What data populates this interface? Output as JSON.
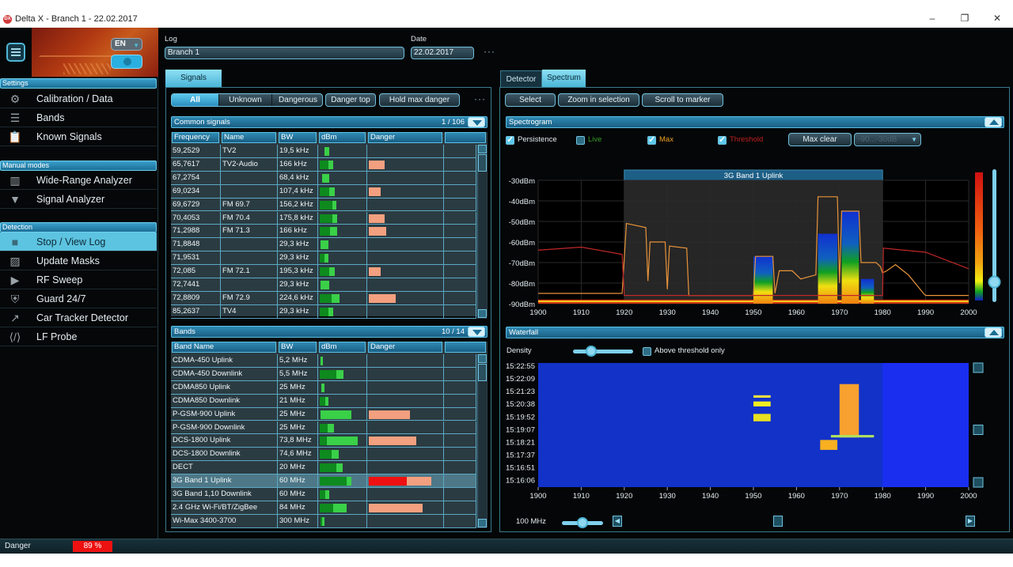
{
  "window": {
    "title": "Delta X - Branch 1 - 22.02.2017",
    "app_icon": "DX",
    "minimize": "–",
    "maximize": "❐",
    "close": "✕"
  },
  "sidebar": {
    "language": "EN",
    "sections": [
      {
        "label": "Settings",
        "items": [
          {
            "label": "Calibration / Data",
            "icon": "gear-icon",
            "glyph": "⚙"
          },
          {
            "label": "Bands",
            "icon": "list-icon",
            "glyph": "☰"
          },
          {
            "label": "Known Signals",
            "icon": "clipboard-icon",
            "glyph": "📋"
          }
        ]
      },
      {
        "label": "Manual modes",
        "items": [
          {
            "label": "Wide-Range Analyzer",
            "icon": "bar-chart-icon",
            "glyph": "▥"
          },
          {
            "label": "Signal Analyzer",
            "icon": "info-shield-icon",
            "glyph": "▼"
          }
        ]
      },
      {
        "label": "Detection",
        "items": [
          {
            "label": "Stop / View Log",
            "icon": "stop-icon",
            "glyph": "■",
            "active": true
          },
          {
            "label": "Update Masks",
            "icon": "image-icon",
            "glyph": "▨"
          },
          {
            "label": "RF Sweep",
            "icon": "play-icon",
            "glyph": "▶"
          },
          {
            "label": "Guard 24/7",
            "icon": "shield-check-icon",
            "glyph": "⛨"
          },
          {
            "label": "Car Tracker Detector",
            "icon": "trend-icon",
            "glyph": "↗"
          },
          {
            "label": "LF Probe",
            "icon": "code-link-icon",
            "glyph": "⟨/⟩"
          }
        ]
      }
    ]
  },
  "header": {
    "log_label": "Log",
    "log_value": "Branch 1",
    "date_label": "Date",
    "date_value": "22.02.2017",
    "more": "···"
  },
  "signals": {
    "tab": "Signals",
    "filters": [
      "All",
      "Unknown",
      "Dangerous"
    ],
    "active_filter": "All",
    "danger_top": "Danger top",
    "hold_max_danger": "Hold max danger",
    "more": "···",
    "common": {
      "title": "Common signals",
      "count": "1 / 106",
      "columns": [
        "Frequency",
        "Name",
        "BW",
        "dBm",
        "Danger",
        ""
      ],
      "rows": [
        {
          "freq": "59,2529",
          "name": "TV2",
          "bw": "19,5 kHz",
          "dbm_dark": 0.0,
          "dbm_light": 0.12,
          "dbm_offset": 0.1,
          "danger": 0
        },
        {
          "freq": "65,7617",
          "name": "TV2-Audio",
          "bw": "166 kHz",
          "dbm_dark": 0.2,
          "dbm_light": 0.1,
          "dbm_offset": 0,
          "danger": 0.22
        },
        {
          "freq": "67,2754",
          "name": "",
          "bw": "68,4 kHz",
          "dbm_dark": 0.0,
          "dbm_light": 0.15,
          "dbm_offset": 0.06,
          "danger": 0
        },
        {
          "freq": "69,0234",
          "name": "",
          "bw": "107,4 kHz",
          "dbm_dark": 0.22,
          "dbm_light": 0.12,
          "dbm_offset": 0,
          "danger": 0.17
        },
        {
          "freq": "69,6729",
          "name": "FM 69.7",
          "bw": "156,2 kHz",
          "dbm_dark": 0.28,
          "dbm_light": 0.1,
          "dbm_offset": 0,
          "danger": 0
        },
        {
          "freq": "70,4053",
          "name": "FM 70.4",
          "bw": "175,8 kHz",
          "dbm_dark": 0.28,
          "dbm_light": 0.12,
          "dbm_offset": 0,
          "danger": 0.22
        },
        {
          "freq": "71,2988",
          "name": "FM 71.3",
          "bw": "166 kHz",
          "dbm_dark": 0.24,
          "dbm_light": 0.16,
          "dbm_offset": 0,
          "danger": 0.24
        },
        {
          "freq": "71,8848",
          "name": "",
          "bw": "29,3 kHz",
          "dbm_dark": 0.0,
          "dbm_light": 0.18,
          "dbm_offset": 0.02,
          "danger": 0
        },
        {
          "freq": "71,9531",
          "name": "",
          "bw": "29,3 kHz",
          "dbm_dark": 0.1,
          "dbm_light": 0.1,
          "dbm_offset": 0,
          "danger": 0
        },
        {
          "freq": "72,085",
          "name": "FM 72.1",
          "bw": "195,3 kHz",
          "dbm_dark": 0.22,
          "dbm_light": 0.12,
          "dbm_offset": 0,
          "danger": 0.17
        },
        {
          "freq": "72,7441",
          "name": "",
          "bw": "29,3 kHz",
          "dbm_dark": 0.0,
          "dbm_light": 0.2,
          "dbm_offset": 0.02,
          "danger": 0
        },
        {
          "freq": "72,8809",
          "name": "FM 72.9",
          "bw": "224,6 kHz",
          "dbm_dark": 0.26,
          "dbm_light": 0.18,
          "dbm_offset": 0,
          "danger": 0.37
        },
        {
          "freq": "85,2637",
          "name": "TV4",
          "bw": "29,3 kHz",
          "dbm_dark": 0.2,
          "dbm_light": 0.1,
          "dbm_offset": 0,
          "danger": 0
        }
      ]
    },
    "bands": {
      "title": "Bands",
      "count": "10 / 14",
      "columns": [
        "Band Name",
        "BW",
        "dBm",
        "Danger",
        ""
      ],
      "rows": [
        {
          "name": "CDMA-450 Uplink",
          "bw": "5,2 MHz",
          "dbm_dark": 0.0,
          "dbm_light": 0.05,
          "dbm_offset": 0.02,
          "danger": 0,
          "danger_red": 0
        },
        {
          "name": "CDMA-450 Downlink",
          "bw": "5,5 MHz",
          "dbm_dark": 0.38,
          "dbm_light": 0.15,
          "dbm_offset": 0,
          "danger": 0,
          "danger_red": 0
        },
        {
          "name": "CDMA850 Uplink",
          "bw": "25 MHz",
          "dbm_dark": 0.0,
          "dbm_light": 0.07,
          "dbm_offset": 0.04,
          "danger": 0,
          "danger_red": 0
        },
        {
          "name": "CDMA850 Downlink",
          "bw": "21 MHz",
          "dbm_dark": 0.12,
          "dbm_light": 0.08,
          "dbm_offset": 0,
          "danger": 0,
          "danger_red": 0
        },
        {
          "name": "P-GSM-900 Uplink",
          "bw": "25 MHz",
          "dbm_dark": 0.0,
          "dbm_light": 0.7,
          "dbm_offset": 0.02,
          "danger": 0.57,
          "danger_red": 0
        },
        {
          "name": "P-GSM-900 Downlink",
          "bw": "25 MHz",
          "dbm_dark": 0.18,
          "dbm_light": 0.14,
          "dbm_offset": 0,
          "danger": 0,
          "danger_red": 0
        },
        {
          "name": "DCS-1800 Uplink",
          "bw": "73,8 MHz",
          "dbm_dark": 0.16,
          "dbm_light": 0.7,
          "dbm_offset": 0,
          "danger": 0.66,
          "danger_red": 0
        },
        {
          "name": "DCS-1800 Downlink",
          "bw": "74,6 MHz",
          "dbm_dark": 0.27,
          "dbm_light": 0.16,
          "dbm_offset": 0,
          "danger": 0,
          "danger_red": 0
        },
        {
          "name": "DECT",
          "bw": "20 MHz",
          "dbm_dark": 0.38,
          "dbm_light": 0.14,
          "dbm_offset": 0,
          "danger": 0,
          "danger_red": 0
        },
        {
          "name": "3G Band 1 Uplink",
          "bw": "60 MHz",
          "dbm_dark": 0.6,
          "dbm_light": 0.12,
          "dbm_offset": 0,
          "danger": 0.87,
          "danger_red": 0.53,
          "selected": true
        },
        {
          "name": "3G Band 1,10 Downlink",
          "bw": "60 MHz",
          "dbm_dark": 0.12,
          "dbm_light": 0.1,
          "dbm_offset": 0,
          "danger": 0,
          "danger_red": 0
        },
        {
          "name": "2.4 GHz Wi-Fi/BT/ZigBee",
          "bw": "84 MHz",
          "dbm_dark": 0.3,
          "dbm_light": 0.3,
          "dbm_offset": 0,
          "danger": 0.75,
          "danger_red": 0
        },
        {
          "name": "Wi-Max 3400-3700",
          "bw": "300 MHz",
          "dbm_dark": 0.04,
          "dbm_light": 0.04,
          "dbm_offset": 0.02,
          "danger": 0,
          "danger_red": 0
        }
      ]
    }
  },
  "spectrum_panel": {
    "tabs": [
      "Detector",
      "Spectrum"
    ],
    "active_tab": "Spectrum",
    "toolbar": [
      "Select",
      "Zoom in selection",
      "Scroll to marker"
    ],
    "spectrogram": {
      "title": "Spectrogram",
      "checks": [
        {
          "label": "Persistence",
          "checked": true,
          "color": "#e6eef2"
        },
        {
          "label": "Live",
          "checked": false,
          "color": "#3a9a2a"
        },
        {
          "label": "Max",
          "checked": true,
          "color": "#f0a020"
        },
        {
          "label": "Threshold",
          "checked": true,
          "color": "#c02020"
        }
      ],
      "max_clear": "Max clear",
      "range_select": "-90...-30dB"
    },
    "waterfall": {
      "title": "Waterfall",
      "density_label": "Density",
      "density_value": 0.3,
      "above_threshold_label": "Above threshold only",
      "above_threshold_checked": false,
      "span_label": "100 MHz",
      "span_slider": 0.5,
      "h_scroll": 0.45
    }
  },
  "chart_data": [
    {
      "type": "line",
      "title": "Spectrogram",
      "xlabel": "",
      "ylabel": "",
      "xlim": [
        1900,
        2000
      ],
      "ylim": [
        -90,
        -30
      ],
      "x_ticks": [
        "1900",
        "1910",
        "1920",
        "1930",
        "1940",
        "1950",
        "1960",
        "1970",
        "1980",
        "1990",
        "2000"
      ],
      "y_ticks": [
        "-30dBm",
        "-40dBm",
        "-50dBm",
        "-60dBm",
        "-70dBm",
        "-80dBm",
        "-90dBm"
      ],
      "grid": true,
      "selection": {
        "label": "3G Band 1 Uplink",
        "x_start": 1920,
        "x_end": 1980
      },
      "series": [
        {
          "name": "Max",
          "color": "#e8943a",
          "x": [
            1900,
            1919.5,
            1920.5,
            1925,
            1925.5,
            1926,
            1929.5,
            1930,
            1930.5,
            1934.5,
            1935,
            1950,
            1950.5,
            1954.5,
            1955,
            1956,
            1959,
            1961,
            1964.5,
            1965,
            1969.5,
            1970,
            1970.5,
            1974.5,
            1975,
            1978.5,
            1979.5,
            1980,
            1981,
            1983,
            1986,
            1989.5,
            1990,
            2000
          ],
          "y": [
            -85,
            -85,
            -51,
            -53,
            -79,
            -60,
            -60,
            -83,
            -62,
            -63,
            -86,
            -86,
            -67,
            -67,
            -85,
            -74,
            -74,
            -78,
            -76,
            -38,
            -38,
            -80,
            -45,
            -45,
            -70,
            -70,
            -72,
            -75,
            -74,
            -71,
            -76,
            -85,
            -86,
            -86
          ]
        },
        {
          "name": "Threshold",
          "color": "#c02828",
          "x": [
            1900,
            1910,
            1919.5,
            1920,
            1980,
            1980.2,
            1990,
            2000
          ],
          "y": [
            -64,
            -62.5,
            -66,
            -86,
            -86,
            -63,
            -65,
            -73
          ]
        }
      ],
      "persistence_blocks": [
        {
          "x_start": 1950,
          "x_end": 1954.5,
          "top": -67
        },
        {
          "x_start": 1965,
          "x_end": 1969.5,
          "top": -56
        },
        {
          "x_start": 1970.5,
          "x_end": 1974.5,
          "top": -45
        },
        {
          "x_start": 1975,
          "x_end": 1978,
          "top": -78
        }
      ],
      "colorbar": {
        "min": -90,
        "max": -30,
        "level": 0.15
      }
    },
    {
      "type": "heatmap",
      "title": "Waterfall",
      "xlim": [
        1900,
        2000
      ],
      "x_ticks": [
        "1900",
        "1910",
        "1920",
        "1930",
        "1940",
        "1950",
        "1960",
        "1970",
        "1980",
        "1990",
        "2000"
      ],
      "y_ticks": [
        "15:22:55",
        "15:22:09",
        "15:21:23",
        "15:20:38",
        "15:19:52",
        "15:19:07",
        "15:18:21",
        "15:17:37",
        "15:16:51",
        "15:16:06"
      ],
      "events": [
        {
          "x_start": 1950,
          "x_end": 1954,
          "t_start": 0.26,
          "t_end": 0.28,
          "color": "#f0e040"
        },
        {
          "x_start": 1950,
          "x_end": 1954,
          "t_start": 0.31,
          "t_end": 0.35,
          "color": "#f2f020"
        },
        {
          "x_start": 1950,
          "x_end": 1954,
          "t_start": 0.41,
          "t_end": 0.47,
          "color": "#e8e020"
        },
        {
          "x_start": 1970,
          "x_end": 1974.5,
          "t_start": 0.17,
          "t_end": 0.6,
          "color": "#f8a030"
        },
        {
          "x_start": 1968,
          "x_end": 1978,
          "t_start": 0.58,
          "t_end": 0.6,
          "color": "#b0e060"
        },
        {
          "x_start": 1965.5,
          "x_end": 1969.5,
          "t_start": 0.62,
          "t_end": 0.7,
          "color": "#f8b020"
        }
      ]
    }
  ],
  "status": {
    "label": "Danger",
    "value": "89 %",
    "value_color": "#ee1111"
  }
}
